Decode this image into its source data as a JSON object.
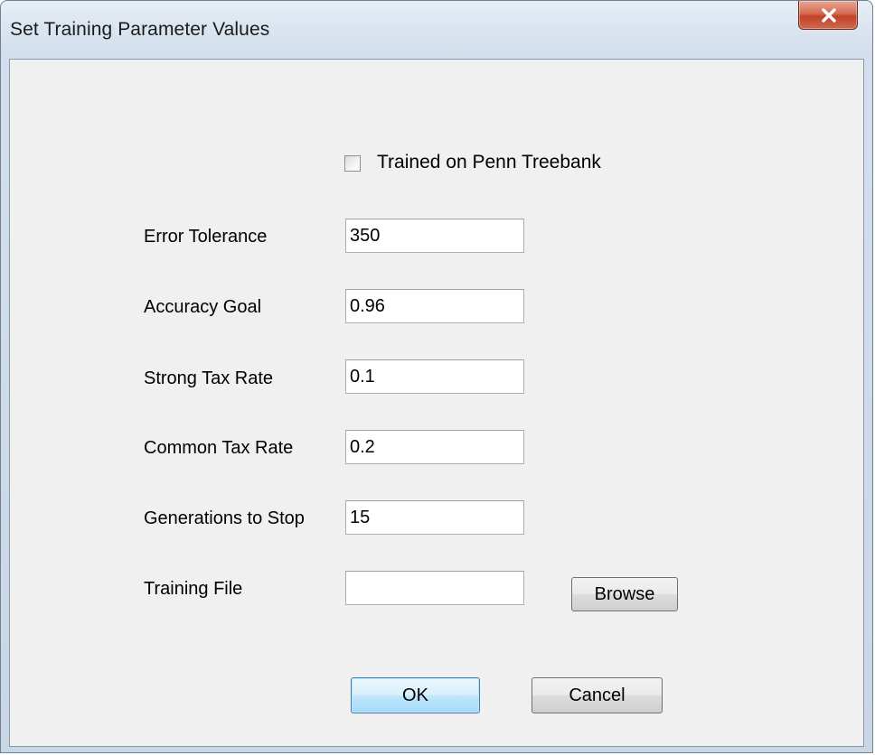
{
  "window": {
    "title": "Set Training Parameter Values"
  },
  "checkbox": {
    "label": "Trained on Penn Treebank",
    "checked": false
  },
  "fields": [
    {
      "label": "Error Tolerance",
      "value": "350"
    },
    {
      "label": "Accuracy Goal",
      "value": "0.96"
    },
    {
      "label": "Strong Tax Rate",
      "value": "0.1"
    },
    {
      "label": "Common Tax Rate",
      "value": "0.2"
    },
    {
      "label": "Generations to Stop",
      "value": "15"
    },
    {
      "label": "Training File",
      "value": ""
    }
  ],
  "buttons": {
    "browse": "Browse",
    "ok": "OK",
    "cancel": "Cancel"
  },
  "icons": {
    "close": "close-icon"
  },
  "colors": {
    "close_button": "#c1432a",
    "client_background": "#f0f0f0",
    "default_button_border": "#3c7fb1"
  }
}
